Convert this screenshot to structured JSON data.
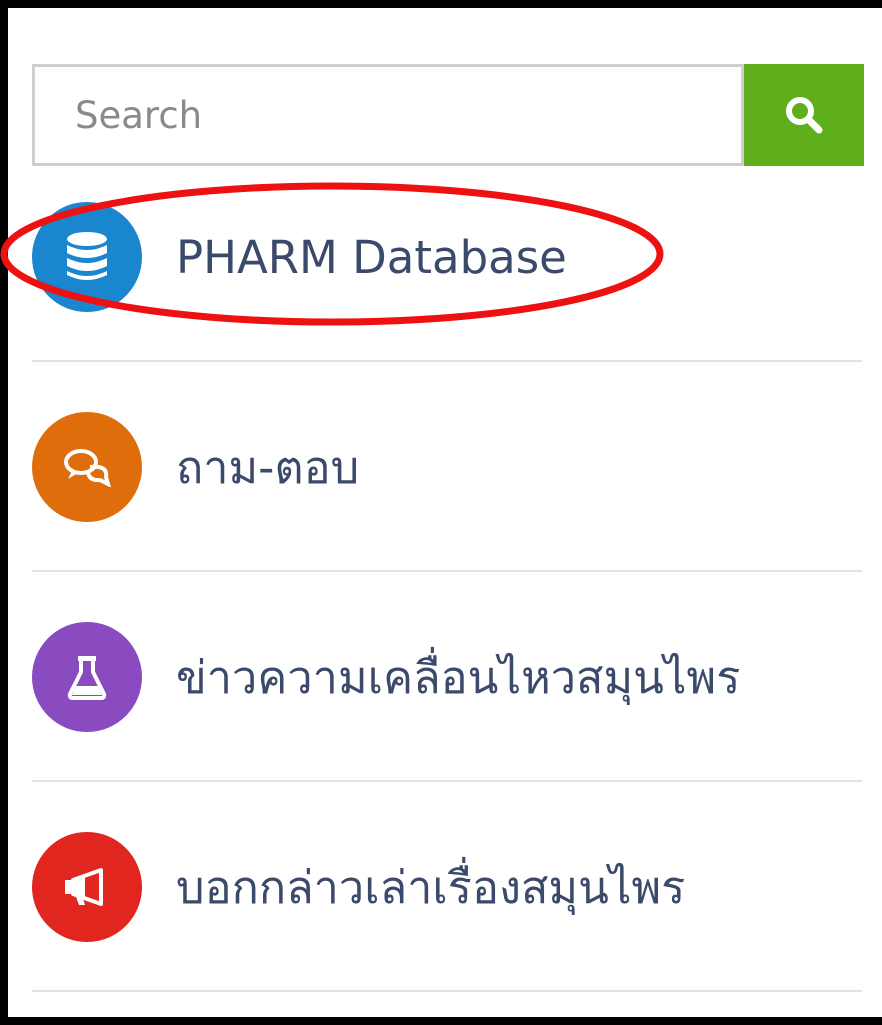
{
  "search": {
    "placeholder": "Search"
  },
  "menu": {
    "items": [
      {
        "label": "PHARM Database",
        "icon": "database-icon",
        "color": "#1b86d0"
      },
      {
        "label": "ถาม-ตอบ",
        "icon": "chat-bubbles-icon",
        "color": "#e06d0c"
      },
      {
        "label": "ข่าวความเคลื่อนไหวสมุนไพร",
        "icon": "flask-icon",
        "color": "#8a4ac0"
      },
      {
        "label": "บอกกล่าวเล่าเรื่องสมุนไพร",
        "icon": "megaphone-icon",
        "color": "#e0261e"
      }
    ]
  },
  "colors": {
    "search_button": "#5fae1c",
    "highlight": "#ee1111",
    "label_text": "#3b4a6b"
  }
}
